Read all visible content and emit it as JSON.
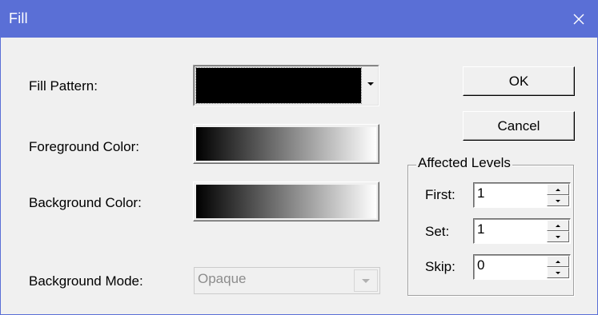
{
  "window": {
    "title": "Fill",
    "title_bar_color": "#5a6fd6",
    "close_icon": "close-icon"
  },
  "labels": {
    "fill_pattern": "Fill Pattern:",
    "foreground_color": "Foreground Color:",
    "background_color": "Background Color:",
    "background_mode": "Background Mode:"
  },
  "fill_pattern": {
    "selected_color": "#000000",
    "dropdown_icon": "chevron-down-icon"
  },
  "foreground_color": {
    "gradient_from": "#000000",
    "gradient_to": "#ffffff"
  },
  "background_color": {
    "gradient_from": "#000000",
    "gradient_to": "#ffffff"
  },
  "background_mode": {
    "value": "Opaque",
    "disabled": true
  },
  "buttons": {
    "ok": "OK",
    "cancel": "Cancel"
  },
  "affected_levels": {
    "title": "Affected Levels",
    "first_label": "First:",
    "first_value": "1",
    "set_label": "Set:",
    "set_value": "1",
    "skip_label": "Skip:",
    "skip_value": "0"
  }
}
